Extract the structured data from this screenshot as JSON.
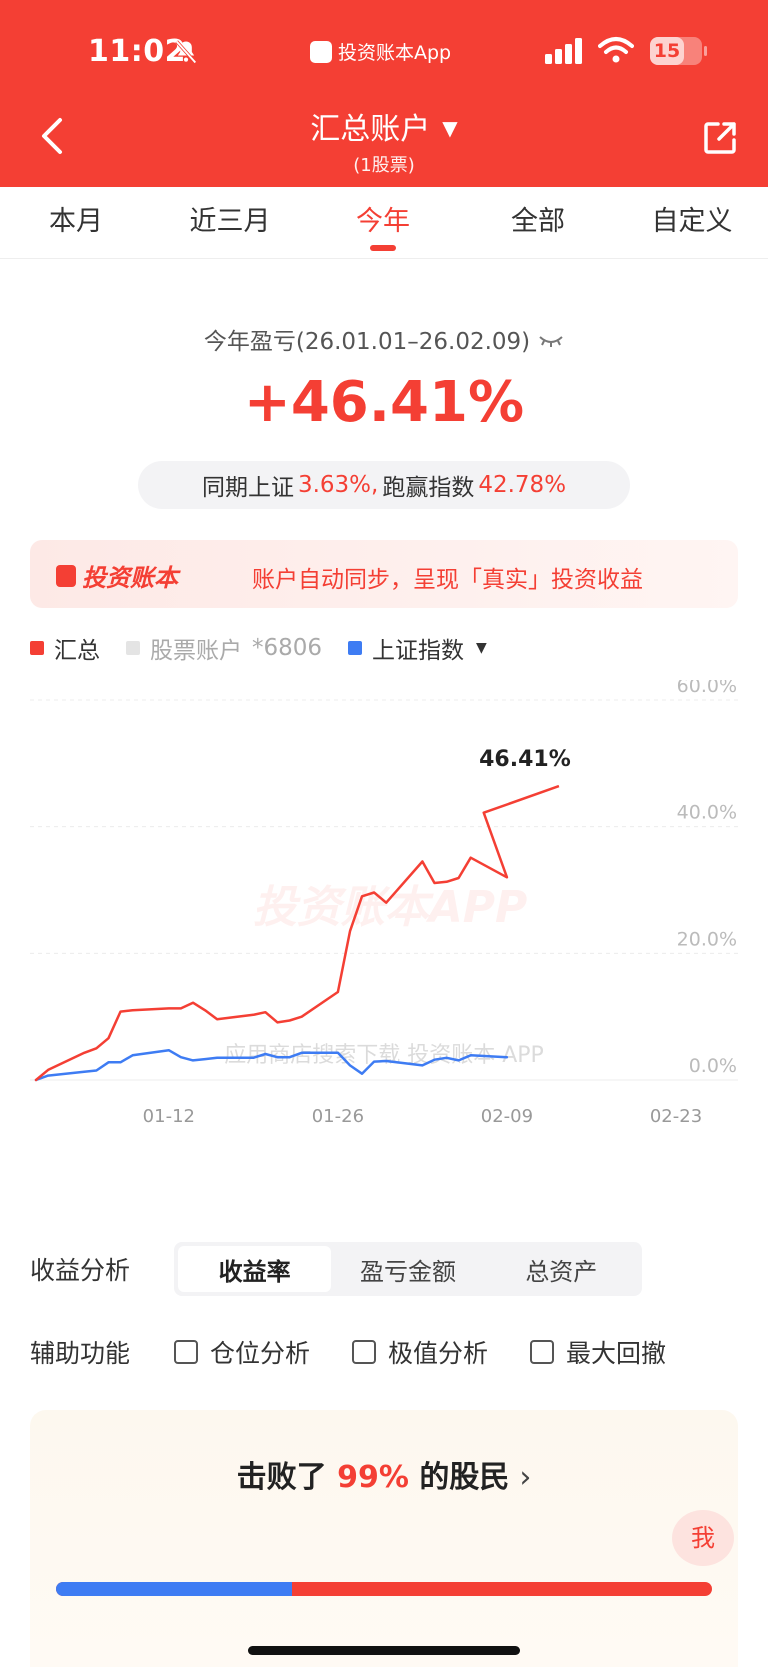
{
  "status_bar": {
    "time": "11:02",
    "app_badge": "投资账本App",
    "battery": "15"
  },
  "nav": {
    "title": "汇总账户",
    "subtitle": "(1股票)"
  },
  "tabs": [
    {
      "label": "本月"
    },
    {
      "label": "近三月"
    },
    {
      "label": "今年",
      "active": true
    },
    {
      "label": "全部"
    },
    {
      "label": "自定义"
    }
  ],
  "summary": {
    "period_label": "今年盈亏(26.01.01–26.02.09)",
    "return_value": "+46.41%",
    "compare_prefix": "同期上证",
    "compare_index_value": "3.63%,",
    "compare_mid": "跑赢指数",
    "compare_excess_value": "42.78%"
  },
  "banner": {
    "brand": "投资账本",
    "slogan": "账户自动同步，呈现「真实」投资收益"
  },
  "legend": {
    "total": "汇总",
    "stock_account": "股票账户",
    "stock_account_no": "*6806",
    "index": "上证指数"
  },
  "colors": {
    "accent": "#f43f34",
    "index_blue": "#3e7cf3",
    "inactive_grey": "#dddddd"
  },
  "chart_data": {
    "type": "line",
    "y_ticks": [
      "60.0%",
      "40.0%",
      "20.0%",
      "0.0%"
    ],
    "ylim": [
      0,
      60
    ],
    "x_ticks": [
      "01-12",
      "01-26",
      "02-09",
      "02-23"
    ],
    "end_label": "46.41%",
    "watermark": "投资账本APP",
    "watermark_footer": "应用商店搜索下载 投资账本 APP",
    "series": [
      {
        "name": "汇总",
        "color": "#f43f34",
        "x": [
          "01-01",
          "01-02",
          "01-05",
          "01-06",
          "01-07",
          "01-08",
          "01-09",
          "01-12",
          "01-13",
          "01-14",
          "01-15",
          "01-16",
          "01-19",
          "01-20",
          "01-21",
          "01-22",
          "01-23",
          "01-26",
          "01-27",
          "01-28",
          "01-29",
          "01-30",
          "02-02",
          "02-03",
          "02-04",
          "02-05",
          "02-06",
          "02-09"
        ],
        "values": [
          0.0,
          1.6,
          4.3,
          5.0,
          6.6,
          10.8,
          11.0,
          11.3,
          11.3,
          12.2,
          11.0,
          9.6,
          10.3,
          10.7,
          9.1,
          9.4,
          10.0,
          13.9,
          23.5,
          29.0,
          29.6,
          28.0,
          34.5,
          31.1,
          31.3,
          31.9,
          35.1,
          32.0
        ]
      },
      {
        "name": "上证指数",
        "color": "#3e7cf3",
        "x": [
          "01-01",
          "01-02",
          "01-05",
          "01-06",
          "01-07",
          "01-08",
          "01-09",
          "01-12",
          "01-13",
          "01-14",
          "01-15",
          "01-16",
          "01-19",
          "01-20",
          "01-21",
          "01-22",
          "01-23",
          "01-26",
          "01-27",
          "01-28",
          "01-29",
          "01-30",
          "02-02",
          "02-03",
          "02-04",
          "02-05",
          "02-06",
          "02-09"
        ],
        "values": [
          0.0,
          0.7,
          1.3,
          1.5,
          2.8,
          2.8,
          3.9,
          4.7,
          3.6,
          3.1,
          3.3,
          3.5,
          3.5,
          4.1,
          3.6,
          3.6,
          4.3,
          4.3,
          2.3,
          1.0,
          2.9,
          3.0,
          2.3,
          3.2,
          3.5,
          3.1,
          3.9,
          3.6
        ]
      }
    ]
  },
  "analysis": {
    "label": "收益分析",
    "options": [
      "收益率",
      "盈亏金额",
      "总资产"
    ]
  },
  "aux": {
    "label": "辅助功能",
    "options": [
      "仓位分析",
      "极值分析",
      "最大回撤"
    ]
  },
  "beat": {
    "prefix": "击败了",
    "percent": "99%",
    "suffix": "的股民",
    "me_label": "我",
    "progress": 0.36
  }
}
